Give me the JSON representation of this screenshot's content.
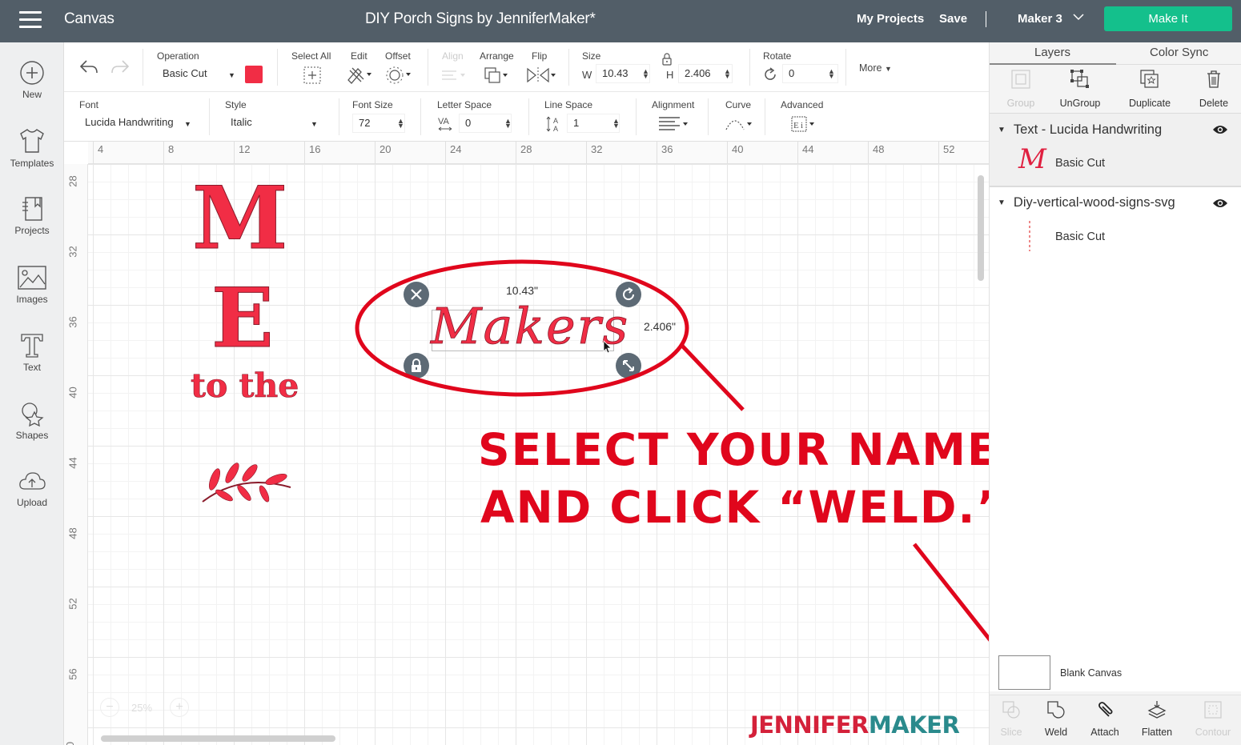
{
  "topbar": {
    "app_name": "Canvas",
    "doc_title": "DIY Porch Signs by JenniferMaker*",
    "my_projects": "My Projects",
    "save": "Save",
    "machine": "Maker 3",
    "make_it": "Make It"
  },
  "sidebar": {
    "items": [
      {
        "label": "New",
        "icon": "plus-circle-icon"
      },
      {
        "label": "Templates",
        "icon": "tshirt-icon"
      },
      {
        "label": "Projects",
        "icon": "notebook-icon"
      },
      {
        "label": "Images",
        "icon": "image-icon"
      },
      {
        "label": "Text",
        "icon": "text-t-icon"
      },
      {
        "label": "Shapes",
        "icon": "shapes-icon"
      },
      {
        "label": "Upload",
        "icon": "cloud-upload-icon"
      }
    ]
  },
  "toolbar": {
    "operation_label": "Operation",
    "operation_value": "Basic Cut",
    "operation_color": "#f12d45",
    "select_all": "Select All",
    "edit": "Edit",
    "offset": "Offset",
    "align": "Align",
    "arrange": "Arrange",
    "flip": "Flip",
    "size_label": "Size",
    "w_label": "W",
    "w_value": "10.43",
    "h_label": "H",
    "h_value": "2.406",
    "rotate_label": "Rotate",
    "rotate_value": "0",
    "more": "More"
  },
  "textbar": {
    "font_label": "Font",
    "font_value": "Lucida Handwriting",
    "style_label": "Style",
    "style_value": "Italic",
    "font_size_label": "Font Size",
    "font_size_value": "72",
    "letter_space_label": "Letter Space",
    "letter_space_value": "0",
    "line_space_label": "Line Space",
    "line_space_value": "1",
    "alignment_label": "Alignment",
    "curve_label": "Curve",
    "advanced_label": "Advanced"
  },
  "canvas": {
    "ruler_top": [
      "4",
      "8",
      "12",
      "16",
      "20",
      "24",
      "28",
      "32",
      "36",
      "40",
      "44",
      "48",
      "52"
    ],
    "ruler_left": [
      "28",
      "32",
      "36",
      "40",
      "44",
      "48",
      "52",
      "56",
      "0"
    ],
    "design": {
      "letter_m": "M",
      "letter_e": "E",
      "to_the": "to the",
      "selected_text": "Makers",
      "width_readout": "10.43\"",
      "height_readout": "2.406\""
    },
    "zoom_level": "25%"
  },
  "annotation": {
    "line1": "SELECT YOUR NAME",
    "line2": "AND CLICK “WELD.”",
    "color": "#e0061c"
  },
  "brand": {
    "part1": "JENNIFER",
    "part2": "MAKER",
    "color1": "#d4213a",
    "color2": "#2a8a8c"
  },
  "panel": {
    "tabs": [
      "Layers",
      "Color Sync"
    ],
    "actions": [
      "Group",
      "UnGroup",
      "Duplicate",
      "Delete"
    ],
    "layers": [
      {
        "name": "Text - Lucida Handwriting",
        "sub": "Basic Cut",
        "thumb": "M"
      },
      {
        "name": "Diy-vertical-wood-signs-svg",
        "sub": "Basic Cut"
      }
    ],
    "blank_canvas": "Blank Canvas",
    "bottom_actions": [
      "Slice",
      "Weld",
      "Attach",
      "Flatten",
      "Contour"
    ]
  }
}
